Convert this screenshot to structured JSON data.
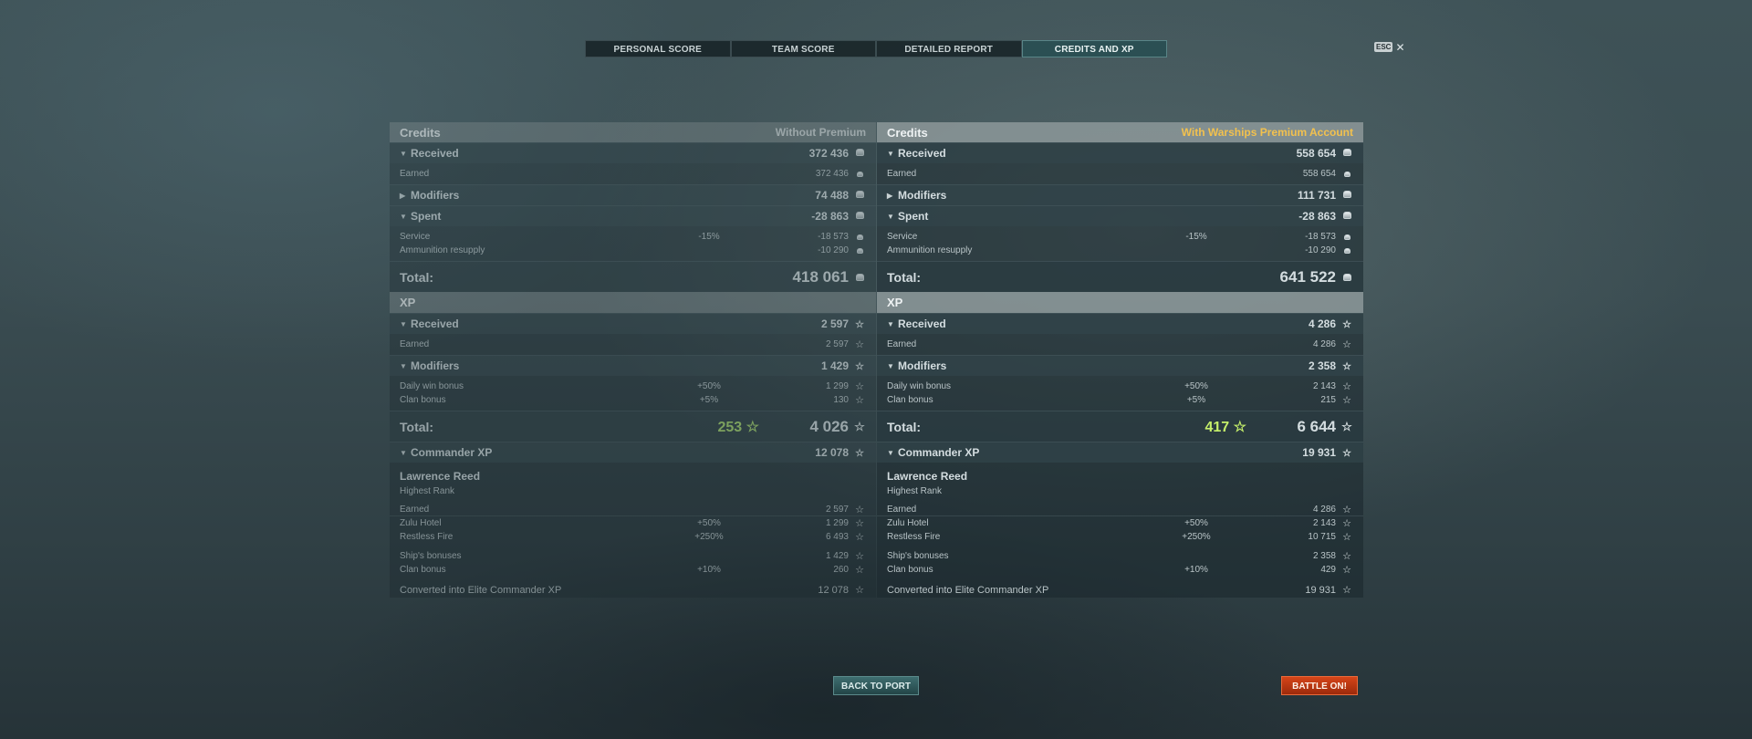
{
  "tabs": [
    "PERSONAL SCORE",
    "TEAM SCORE",
    "DETAILED REPORT",
    "CREDITS AND XP"
  ],
  "active_tab": "CREDITS AND XP",
  "esc": {
    "key": "ESC",
    "close": "✕"
  },
  "left": {
    "credits_header": "Credits",
    "credits_mode": "Without Premium",
    "received_label": "Received",
    "received_value": "372 436",
    "earned_label": "Earned",
    "earned_value": "372 436",
    "modifiers_label": "Modifiers",
    "modifiers_value": "74 488",
    "spent_label": "Spent",
    "spent_value": "-28 863",
    "service_label": "Service",
    "service_pct": "-15%",
    "service_value": "-18 573",
    "ammo_label": "Ammunition resupply",
    "ammo_value": "-10 290",
    "credits_total_label": "Total:",
    "credits_total": "418 061",
    "xp_header": "XP",
    "xp_received_label": "Received",
    "xp_received_value": "2 597",
    "xp_earned_label": "Earned",
    "xp_earned_value": "2 597",
    "xp_modifiers_label": "Modifiers",
    "xp_modifiers_value": "1 429",
    "daily_label": "Daily win bonus",
    "daily_pct": "+50%",
    "daily_value": "1 299",
    "clan_label": "Clan bonus",
    "clan_pct": "+5%",
    "clan_value": "130",
    "xp_total_label": "Total:",
    "xp_free": "253",
    "xp_total": "4 026",
    "cmd_label": "Commander XP",
    "cmd_value": "12 078",
    "cmd_name": "Lawrence Reed",
    "cmd_rank": "Highest Rank",
    "c_earned_label": "Earned",
    "c_earned_value": "2 597",
    "zulu_label": "Zulu Hotel",
    "zulu_pct": "+50%",
    "zulu_value": "1 299",
    "restless_label": "Restless Fire",
    "restless_pct": "+250%",
    "restless_value": "6 493",
    "ship_label": "Ship's bonuses",
    "ship_value": "1 429",
    "c_clan_label": "Clan bonus",
    "c_clan_pct": "+10%",
    "c_clan_value": "260",
    "elite_label": "Converted into Elite Commander XP",
    "elite_value": "12 078"
  },
  "right": {
    "credits_header": "Credits",
    "credits_mode": "With Warships Premium Account",
    "received_label": "Received",
    "received_value": "558 654",
    "earned_label": "Earned",
    "earned_value": "558 654",
    "modifiers_label": "Modifiers",
    "modifiers_value": "111 731",
    "spent_label": "Spent",
    "spent_value": "-28 863",
    "service_label": "Service",
    "service_pct": "-15%",
    "service_value": "-18 573",
    "ammo_label": "Ammunition resupply",
    "ammo_value": "-10 290",
    "credits_total_label": "Total:",
    "credits_total": "641 522",
    "xp_header": "XP",
    "xp_received_label": "Received",
    "xp_received_value": "4 286",
    "xp_earned_label": "Earned",
    "xp_earned_value": "4 286",
    "xp_modifiers_label": "Modifiers",
    "xp_modifiers_value": "2 358",
    "daily_label": "Daily win bonus",
    "daily_pct": "+50%",
    "daily_value": "2 143",
    "clan_label": "Clan bonus",
    "clan_pct": "+5%",
    "clan_value": "215",
    "xp_total_label": "Total:",
    "xp_free": "417",
    "xp_total": "6 644",
    "cmd_label": "Commander XP",
    "cmd_value": "19 931",
    "cmd_name": "Lawrence Reed",
    "cmd_rank": "Highest Rank",
    "c_earned_label": "Earned",
    "c_earned_value": "4 286",
    "zulu_label": "Zulu Hotel",
    "zulu_pct": "+50%",
    "zulu_value": "2 143",
    "restless_label": "Restless Fire",
    "restless_pct": "+250%",
    "restless_value": "10 715",
    "ship_label": "Ship's bonuses",
    "ship_value": "2 358",
    "c_clan_label": "Clan bonus",
    "c_clan_pct": "+10%",
    "c_clan_value": "429",
    "elite_label": "Converted into Elite Commander XP",
    "elite_value": "19 931"
  },
  "buttons": {
    "back": "BACK TO PORT",
    "battle": "BATTLE ON!"
  },
  "colors": {
    "premium": "#f2c14e",
    "free_xp": "#c5ef6a",
    "battle_button": "#c8380f",
    "port_button": "#2f5a5c"
  }
}
